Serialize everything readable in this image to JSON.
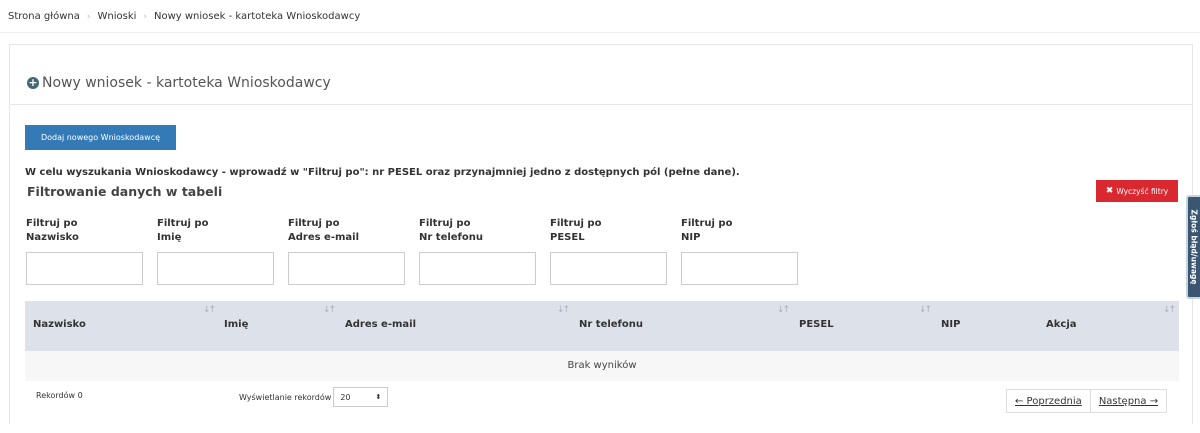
{
  "breadcrumb": {
    "items": [
      "Strona główna",
      "Wnioski",
      "Nowy wniosek - kartoteka Wnioskodawcy"
    ],
    "separator": "›"
  },
  "page": {
    "title": "Nowy wniosek - kartoteka Wnioskodawcy",
    "title_icon": "plus-circle-icon"
  },
  "actions": {
    "add_button": "Dodaj nowego Wnioskodawcę",
    "clear_filters": "Wyczyść filtry",
    "clear_icon": "✖"
  },
  "info_text": "W celu wyszukania Wnioskodawcy - wprowadź w \"Filtruj po\": nr PESEL oraz przynajmniej jedno z dostępnych pól (pełne dane).",
  "filters": {
    "title": "Filtrowanie danych w tabeli",
    "items": [
      {
        "line1": "Filtruj po",
        "line2": "Nazwisko",
        "value": ""
      },
      {
        "line1": "Filtruj po",
        "line2": "Imię",
        "value": ""
      },
      {
        "line1": "Filtruj po",
        "line2": "Adres e-mail",
        "value": ""
      },
      {
        "line1": "Filtruj po",
        "line2": "Nr telefonu",
        "value": ""
      },
      {
        "line1": "Filtruj po",
        "line2": "PESEL",
        "value": ""
      },
      {
        "line1": "Filtruj po",
        "line2": "NIP",
        "value": ""
      }
    ]
  },
  "table": {
    "columns": [
      "Nazwisko",
      "Imię",
      "Adres e-mail",
      "Nr telefonu",
      "PESEL",
      "NIP",
      "Akcja"
    ],
    "sort_icon": "↓↑",
    "empty_text": "Brak wyników"
  },
  "footer": {
    "records_label": "Rekordów 0",
    "per_page_label": "Wyświetlanie rekordów",
    "per_page_value": "20",
    "prev_label": "← Poprzednia",
    "next_label": "Następna →"
  },
  "side_tab": {
    "label": "Zgłoś błąd/uwagę"
  },
  "colors": {
    "primary": "#337ab7",
    "danger": "#d9282f",
    "table_header": "#dde2ea",
    "title_icon": "#3f6778"
  }
}
